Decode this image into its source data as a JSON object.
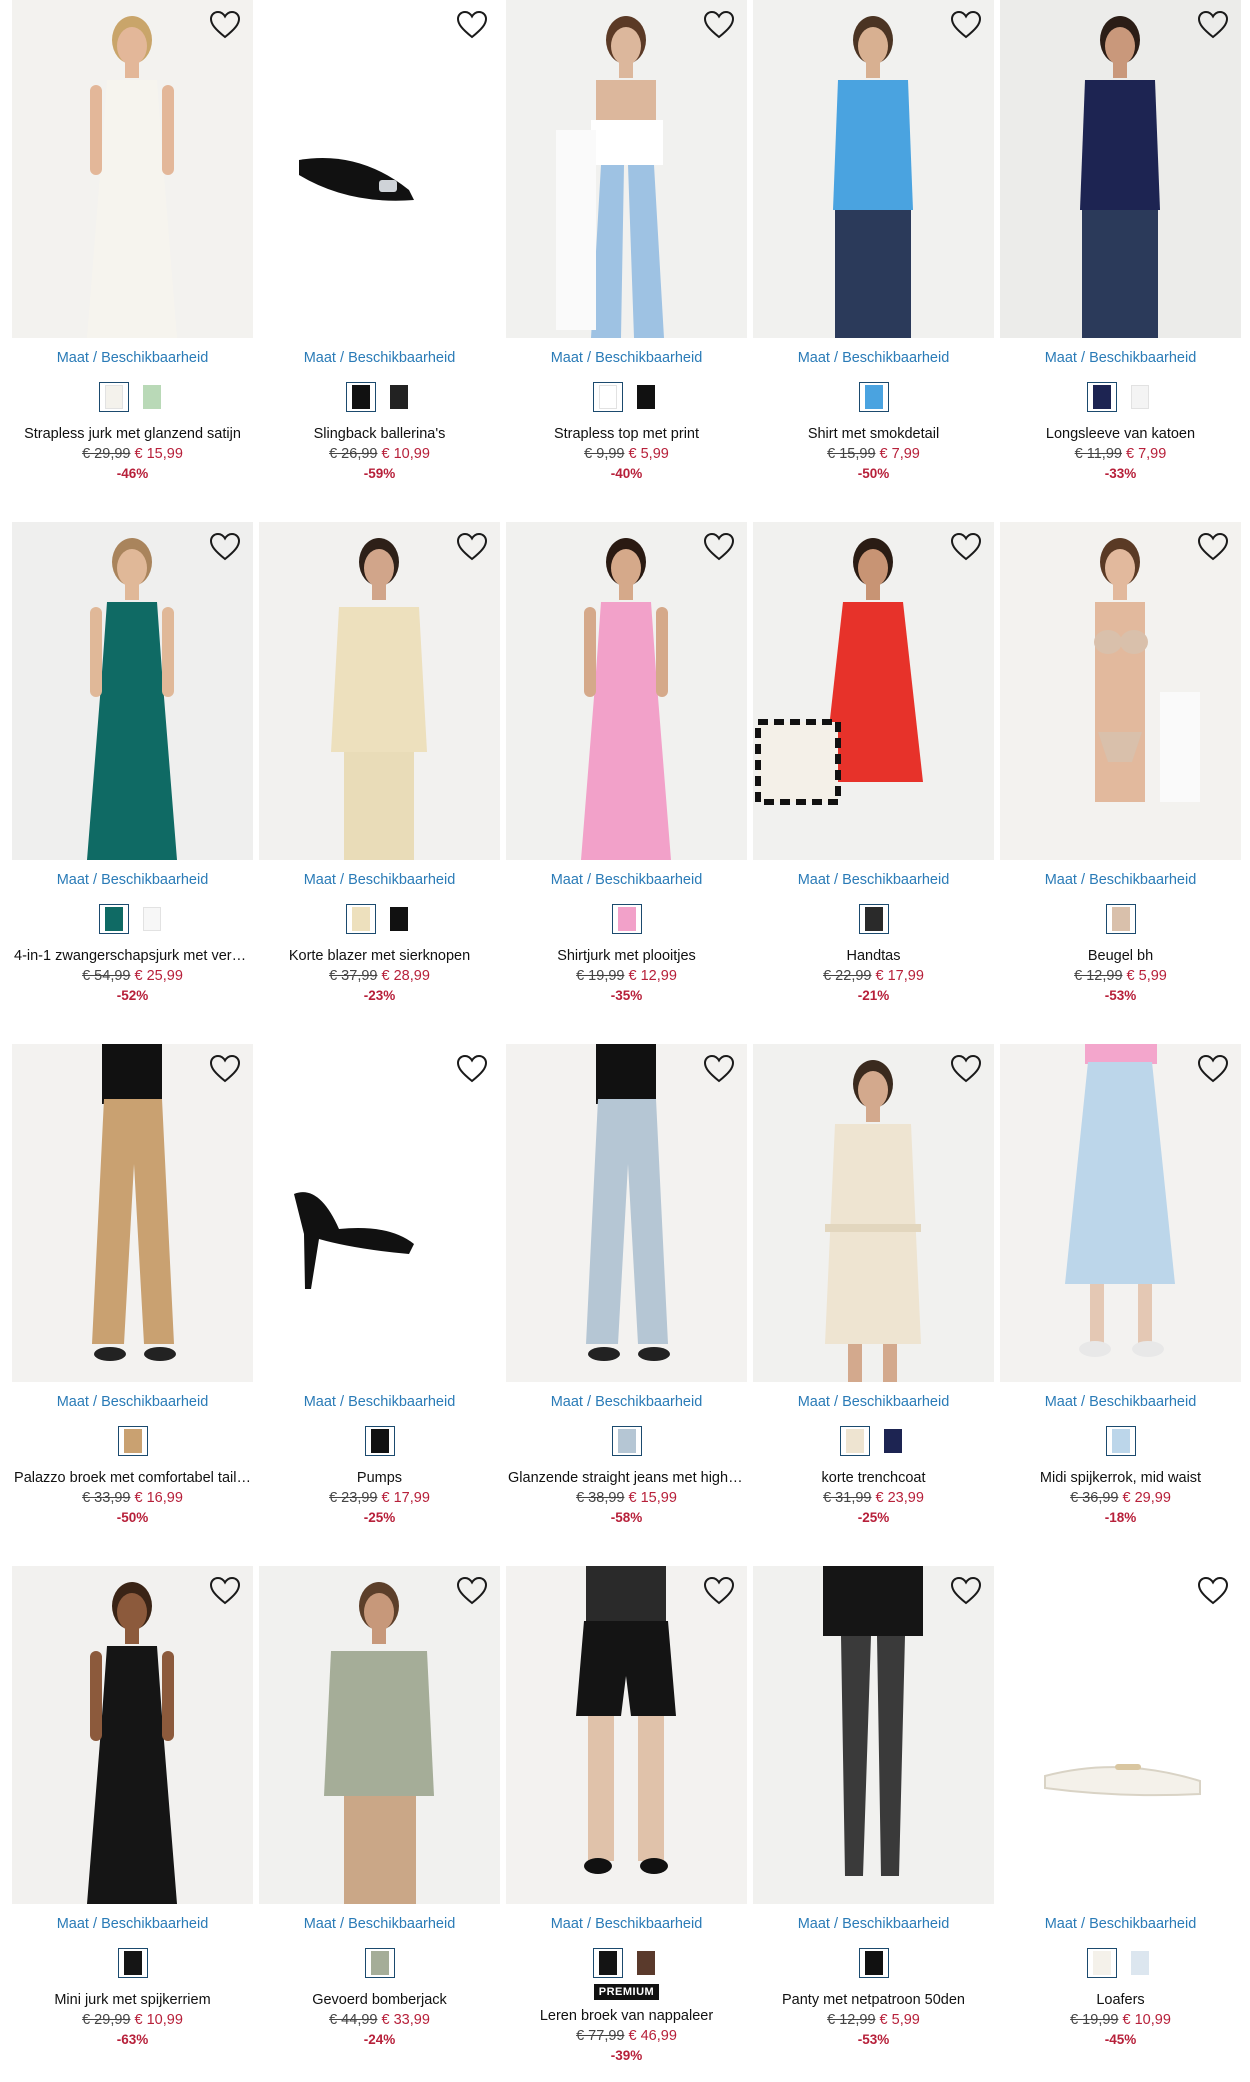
{
  "size_link": {
    "maat": "Maat",
    "sep": "/",
    "beschik": "Beschikbaarheid"
  },
  "premium_label": "PREMIUM",
  "products": [
    {
      "name": "Strapless jurk met glanzend satijn",
      "old": "€ 29,99",
      "new": "€ 15,99",
      "disc": "-46%",
      "bg": "#f3f2ef",
      "body": "#f6f4ee",
      "skin": "#e3b799",
      "hair": "#c9a56a",
      "shape": "dress",
      "swatches": [
        "#f4f2ec",
        "#b9d9b7"
      ]
    },
    {
      "name": "Slingback ballerina's",
      "old": "€ 26,99",
      "new": "€ 10,99",
      "disc": "-59%",
      "bg": "#ffffff",
      "body": "#111111",
      "skin": "#111111",
      "hair": "#111111",
      "shape": "flat",
      "swatches": [
        "#111111",
        "#222222"
      ]
    },
    {
      "name": "Strapless top met print",
      "old": "€ 9,99",
      "new": "€ 5,99",
      "disc": "-40%",
      "bg": "#f1f1ef",
      "body": "#ffffff",
      "skin": "#dcb79c",
      "hair": "#5b3a26",
      "shape": "jeans",
      "swatches": [
        "#ffffff",
        "#111111"
      ]
    },
    {
      "name": "Shirt met smokdetail",
      "old": "€ 15,99",
      "new": "€ 7,99",
      "disc": "-50%",
      "bg": "#f1f1ef",
      "body": "#4aa3e0",
      "skin": "#d8b091",
      "hair": "#4b3423",
      "shape": "top",
      "swatches": [
        "#4aa3e0"
      ]
    },
    {
      "name": "Longsleeve van katoen",
      "old": "€ 11,99",
      "new": "€ 7,99",
      "disc": "-33%",
      "bg": "#ececea",
      "body": "#1d2452",
      "skin": "#c9987b",
      "hair": "#2b1d16",
      "shape": "top",
      "swatches": [
        "#1d2452",
        "#f4f4f4"
      ]
    },
    {
      "name": "4-in-1 zwangerschapsjurk met vers…",
      "old": "€ 54,99",
      "new": "€ 25,99",
      "disc": "-52%",
      "bg": "#efefee",
      "body": "#0f6a64",
      "skin": "#e0b898",
      "hair": "#a9845c",
      "shape": "dress",
      "swatches": [
        "#0f6a64",
        "#f7f7f7"
      ]
    },
    {
      "name": "Korte blazer met sierknopen",
      "old": "€ 37,99",
      "new": "€ 28,99",
      "disc": "-23%",
      "bg": "#f2f1ef",
      "body": "#ede0bd",
      "skin": "#d1a58a",
      "hair": "#2e2018",
      "shape": "suit",
      "swatches": [
        "#ede0bd",
        "#111111"
      ]
    },
    {
      "name": "Shirtjurk met plooitjes",
      "old": "€ 19,99",
      "new": "€ 12,99",
      "disc": "-35%",
      "bg": "#f1f1ef",
      "body": "#f2a1c9",
      "skin": "#d5a98a",
      "hair": "#2a1a12",
      "shape": "dress",
      "swatches": [
        "#f2a1c9"
      ]
    },
    {
      "name": "Handtas",
      "old": "€ 22,99",
      "new": "€ 17,99",
      "disc": "-21%",
      "bg": "#f1f1ef",
      "body": "#e7322a",
      "skin": "#c89474",
      "hair": "#2a1c14",
      "shape": "bag",
      "swatches": [
        "#2a2a2a"
      ]
    },
    {
      "name": "Beugel bh",
      "old": "€ 12,99",
      "new": "€ 5,99",
      "disc": "-53%",
      "bg": "#f3f2ef",
      "body": "#d9c0ab",
      "skin": "#e2b99d",
      "hair": "#5a3a25",
      "shape": "bra",
      "swatches": [
        "#d9c0ab"
      ]
    },
    {
      "name": "Palazzo broek met comfortabel tail…",
      "old": "€ 33,99",
      "new": "€ 16,99",
      "disc": "-50%",
      "bg": "#f3f2f0",
      "body": "#c9a171",
      "skin": "#e3c8b4",
      "hair": "#111111",
      "shape": "pants",
      "swatches": [
        "#c9a171"
      ]
    },
    {
      "name": "Pumps",
      "old": "€ 23,99",
      "new": "€ 17,99",
      "disc": "-25%",
      "bg": "#ffffff",
      "body": "#111111",
      "skin": "#111111",
      "hair": "#111111",
      "shape": "pump",
      "swatches": [
        "#111111"
      ]
    },
    {
      "name": "Glanzende straight jeans met high …",
      "old": "€ 38,99",
      "new": "€ 15,99",
      "disc": "-58%",
      "bg": "#f3f2f0",
      "body": "#b5c6d4",
      "skin": "#dcdcdc",
      "hair": "#111111",
      "shape": "pants",
      "swatches": [
        "#b5c6d4"
      ]
    },
    {
      "name": "korte trenchcoat",
      "old": "€ 31,99",
      "new": "€ 23,99",
      "disc": "-25%",
      "bg": "#f1f1ef",
      "body": "#eee4d1",
      "skin": "#d3a98d",
      "hair": "#3a2a1e",
      "shape": "coat",
      "swatches": [
        "#eee4d1",
        "#1d2452"
      ]
    },
    {
      "name": "Midi spijkerrok, mid waist",
      "old": "€ 36,99",
      "new": "€ 29,99",
      "disc": "-18%",
      "bg": "#f3f2f0",
      "body": "#bcd6ea",
      "skin": "#e4c8b4",
      "hair": "#f3a6cc",
      "shape": "skirt",
      "swatches": [
        "#bcd6ea"
      ]
    },
    {
      "name": "Mini jurk met spijkerriem",
      "old": "€ 29,99",
      "new": "€ 10,99",
      "disc": "-63%",
      "bg": "#f2f1ef",
      "body": "#151515",
      "skin": "#8c5a3c",
      "hair": "#3a2416",
      "shape": "dress",
      "swatches": [
        "#151515"
      ]
    },
    {
      "name": "Gevoerd bomberjack",
      "old": "€ 44,99",
      "new": "€ 33,99",
      "disc": "-24%",
      "bg": "#f1f1ef",
      "body": "#a5ad98",
      "skin": "#c7987a",
      "hair": "#5c3f2a",
      "shape": "jacket",
      "swatches": [
        "#a5ad98"
      ]
    },
    {
      "name": "Leren broek van nappaleer",
      "old": "€ 77,99",
      "new": "€ 46,99",
      "disc": "-39%",
      "bg": "#f3f2f0",
      "body": "#141414",
      "skin": "#e0c2aa",
      "hair": "#141414",
      "shape": "shorts",
      "premium": true,
      "swatches": [
        "#141414",
        "#5a3a2c"
      ]
    },
    {
      "name": "Panty met netpatroon 50den",
      "old": "€ 12,99",
      "new": "€ 5,99",
      "disc": "-53%",
      "bg": "#f1f1ef",
      "body": "#111111",
      "skin": "#e1c6b2",
      "hair": "#111111",
      "shape": "tights",
      "swatches": [
        "#111111"
      ]
    },
    {
      "name": "Loafers",
      "old": "€ 19,99",
      "new": "€ 10,99",
      "disc": "-45%",
      "bg": "#ffffff",
      "body": "#f4f1ea",
      "skin": "#d9c6a0",
      "hair": "#111111",
      "shape": "loafer",
      "swatches": [
        "#f4f1ea",
        "#dce6ef"
      ]
    }
  ]
}
